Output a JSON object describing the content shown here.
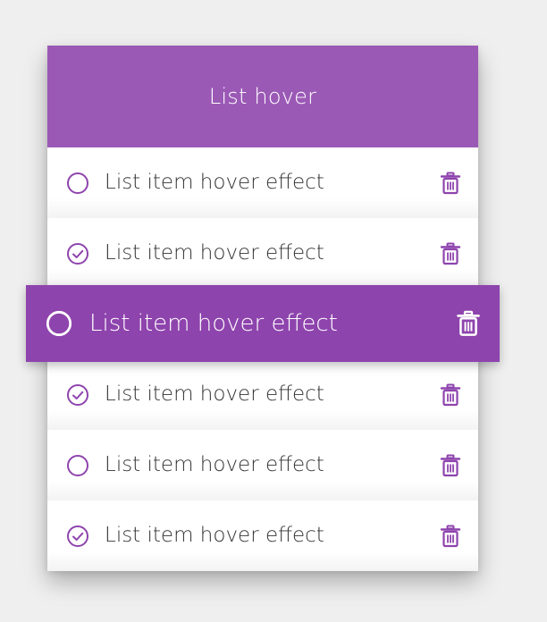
{
  "header": {
    "title": "List hover"
  },
  "colors": {
    "header_bg": "#9b59b6",
    "hover_bg": "#8e44ad",
    "icon_accent": "#8e44ad",
    "text": "#333333"
  },
  "items": [
    {
      "label": "List item hover effect",
      "checked": false,
      "hovered": false
    },
    {
      "label": "List item hover effect",
      "checked": true,
      "hovered": false
    },
    {
      "label": "List item hover effect",
      "checked": false,
      "hovered": true
    },
    {
      "label": "List item hover effect",
      "checked": true,
      "hovered": false
    },
    {
      "label": "List item hover effect",
      "checked": false,
      "hovered": false
    },
    {
      "label": "List item hover effect",
      "checked": true,
      "hovered": false
    }
  ],
  "icons": {
    "unchecked": "circle-icon",
    "checked": "check-circle-icon",
    "delete": "trash-icon"
  }
}
